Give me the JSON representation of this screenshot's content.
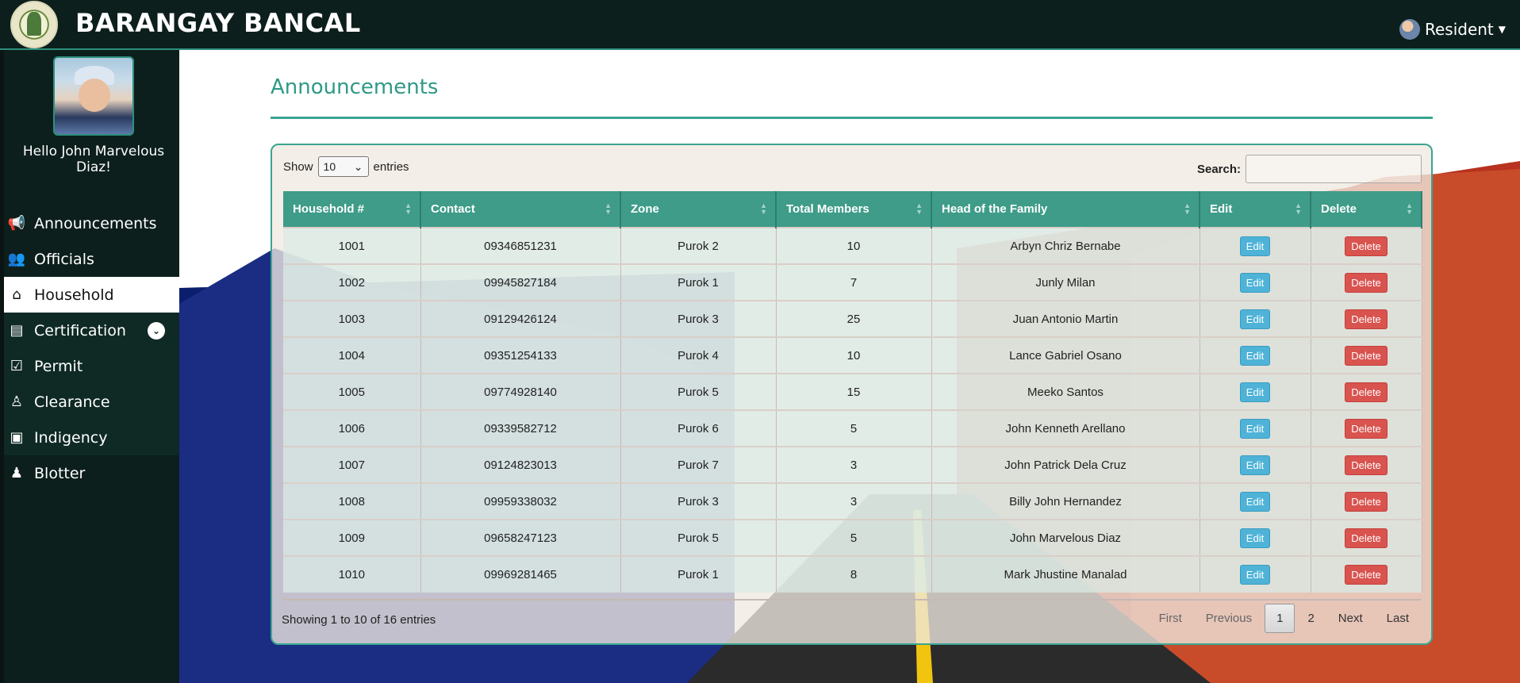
{
  "header": {
    "brand": "BARANGAY BANCAL",
    "user_menu": "Resident"
  },
  "sidebar": {
    "greeting": "Hello John Marvelous Diaz!",
    "items": [
      {
        "label": "Announcements",
        "icon": "bullhorn-icon"
      },
      {
        "label": "Officials",
        "icon": "users-icon"
      },
      {
        "label": "Household",
        "icon": "house-icon"
      },
      {
        "label": "Certification",
        "icon": "certificate-icon"
      },
      {
        "label": "Permit",
        "icon": "clipboard-check-icon"
      },
      {
        "label": "Clearance",
        "icon": "person-check-icon"
      },
      {
        "label": "Indigency",
        "icon": "id-card-icon"
      },
      {
        "label": "Blotter",
        "icon": "person-icon"
      }
    ]
  },
  "page": {
    "title": "Announcements"
  },
  "table_controls": {
    "show_label": "Show",
    "entries_value": "10",
    "entries_label": "entries",
    "search_label": "Search:"
  },
  "table": {
    "columns": [
      "Household #",
      "Contact",
      "Zone",
      "Total Members",
      "Head of the Family",
      "Edit",
      "Delete"
    ],
    "edit_label": "Edit",
    "delete_label": "Delete",
    "rows": [
      {
        "household": "1001",
        "contact": "09346851231",
        "zone": "Purok 2",
        "members": "10",
        "head": "Arbyn Chriz Bernabe"
      },
      {
        "household": "1002",
        "contact": "09945827184",
        "zone": "Purok 1",
        "members": "7",
        "head": "Junly Milan"
      },
      {
        "household": "1003",
        "contact": "09129426124",
        "zone": "Purok 3",
        "members": "25",
        "head": "Juan Antonio Martin"
      },
      {
        "household": "1004",
        "contact": "09351254133",
        "zone": "Purok 4",
        "members": "10",
        "head": "Lance Gabriel Osano"
      },
      {
        "household": "1005",
        "contact": "09774928140",
        "zone": "Purok 5",
        "members": "15",
        "head": "Meeko Santos"
      },
      {
        "household": "1006",
        "contact": "09339582712",
        "zone": "Purok 6",
        "members": "5",
        "head": "John Kenneth Arellano"
      },
      {
        "household": "1007",
        "contact": "09124823013",
        "zone": "Purok 7",
        "members": "3",
        "head": "John Patrick Dela Cruz"
      },
      {
        "household": "1008",
        "contact": "09959338032",
        "zone": "Purok 3",
        "members": "3",
        "head": "Billy John Hernandez"
      },
      {
        "household": "1009",
        "contact": "09658247123",
        "zone": "Purok 5",
        "members": "5",
        "head": "John Marvelous Diaz"
      },
      {
        "household": "1010",
        "contact": "09969281465",
        "zone": "Purok 1",
        "members": "8",
        "head": "Mark Jhustine Manalad"
      }
    ]
  },
  "footer": {
    "showing": "Showing 1 to 10 of 16 entries",
    "pagination": {
      "first": "First",
      "previous": "Previous",
      "pages": [
        "1",
        "2"
      ],
      "next": "Next",
      "last": "Last"
    }
  }
}
